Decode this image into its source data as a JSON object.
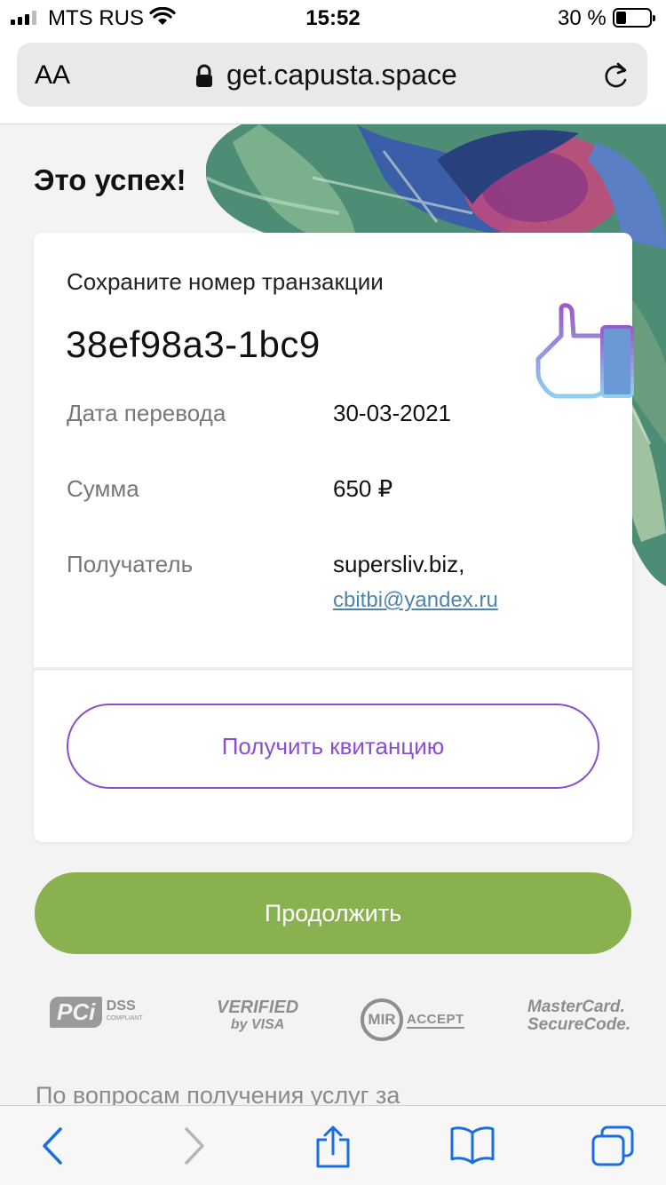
{
  "status_bar": {
    "carrier": "MTS RUS",
    "time": "15:52",
    "battery": "30 %"
  },
  "browser": {
    "text_size_label": "AA",
    "url": "get.capusta.space"
  },
  "page": {
    "title": "Это успех!",
    "card": {
      "save_label": "Сохраните номер транзакции",
      "transaction_id": "38ef98a3-1bc9",
      "rows": [
        {
          "label": "Дата перевода",
          "value": "30-03-2021"
        },
        {
          "label": "Сумма",
          "value": "650 ₽"
        },
        {
          "label": "Получатель",
          "value": "supersliv.biz,"
        }
      ],
      "recipient_email": "cbitbi@yandex.ru",
      "receipt_button": "Получить квитанцию"
    },
    "continue_button": "Продолжить",
    "security_logos": {
      "pci": {
        "box": "PCi",
        "dss": "DSS",
        "sub": "COMPLIANT"
      },
      "visa": {
        "line1": "VERIFIED",
        "line2": "by VISA"
      },
      "mir": {
        "ring": "MIR",
        "accept": "ACCEPT"
      },
      "mastercard": {
        "line1": "MasterCard.",
        "line2": "SecureCode."
      }
    },
    "footer_text": "По вопросам получения услуг за"
  },
  "colors": {
    "accent_purple": "#8a4fce",
    "continue_green": "#8ab14f",
    "link_blue": "#4f84ab",
    "safari_blue": "#1a6fe0"
  }
}
